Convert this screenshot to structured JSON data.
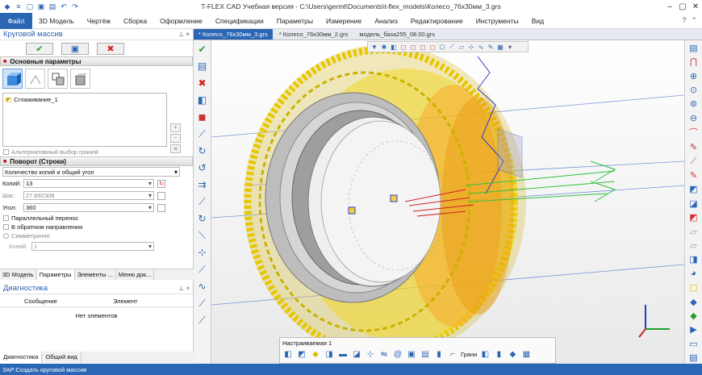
{
  "title": "T-FLEX CAD Учебная версия - C:\\Users\\germt\\Documents\\t-flex_models\\Колесо_76x30мм_3.grs",
  "menu": {
    "file": "Файл",
    "items": [
      "3D Модель",
      "Чертёж",
      "Сборка",
      "Оформление",
      "Спецификации",
      "Параметры",
      "Измерение",
      "Анализ",
      "Редактирование",
      "Инструменты",
      "Вид"
    ]
  },
  "panel": {
    "title": "Круговой массив",
    "pin": "⊥ ×",
    "main_section": "Основные параметры",
    "list_item": "Сглаживание_1",
    "alt_faces": "Альтернативный выбор граней",
    "rotation_section": "Поворот (Строки)",
    "mode": "Количество копий и общий угол",
    "copies_label": "Копий:",
    "copies_value": "13",
    "step_label": "Шаг:",
    "step_value": "27.692308",
    "angle_label": "Угол:",
    "angle_value": "360",
    "parallel": "Параллельный перенос",
    "reverse": "В обратном направлении",
    "symmetric": "Симметрично",
    "copies2_label": "Копий:",
    "copies2_value": "1"
  },
  "panel_tabs": [
    "3D Модель",
    "Параметры",
    "Элементы ...",
    "Меню док..."
  ],
  "diagnostics": {
    "title": "Диагностика",
    "pin": "⊥ ×",
    "col_message": "Сообщение",
    "col_element": "Элемент",
    "empty": "Нет элементов"
  },
  "diag_tabs": [
    "Диагностика",
    "Общий вид"
  ],
  "doc_tabs": [
    "* Колесо_76x30мм_3.grs",
    "* Колесо_76x30мм_2.grs",
    "модель_база255_08.00.grs"
  ],
  "bottom_toolbar": {
    "title": "Настраиваемая 1",
    "faces_label": "Грани"
  },
  "status": "ЗАР:Создать круговой массив",
  "colors": {
    "accent": "#2b66b4",
    "tire_yellow": "#f0d020",
    "rim_gray": "#b8b8b8"
  }
}
